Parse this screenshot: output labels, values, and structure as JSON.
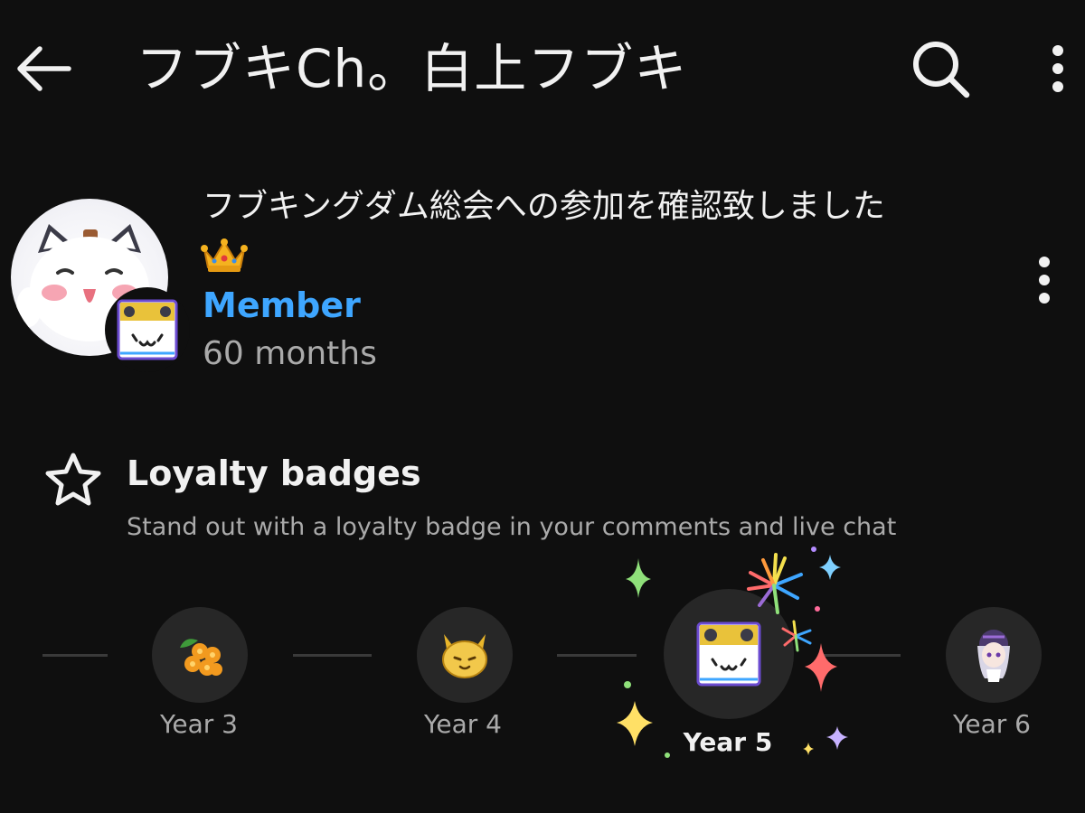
{
  "header": {
    "title": "フブキCh。白上フブキ",
    "back_icon": "arrow-left-icon",
    "search_icon": "search-icon",
    "more_icon": "more-vert-icon"
  },
  "comment": {
    "text": "フブキングダム総会への参加を確認致しました",
    "emoji": "crown-icon",
    "membership": "Member",
    "duration": "60 months"
  },
  "loyalty": {
    "title": "Loyalty badges",
    "subtitle": "Stand out with a loyalty badge in your comments and live chat",
    "badges": [
      {
        "label": "Year 3",
        "icon": "orange-flowers-badge-icon",
        "selected": false
      },
      {
        "label": "Year 4",
        "icon": "golden-fox-badge-icon",
        "selected": false
      },
      {
        "label": "Year 5",
        "icon": "fox-face-badge-icon",
        "selected": true
      },
      {
        "label": "Year 6",
        "icon": "chibi-character-badge-icon",
        "selected": false
      }
    ]
  },
  "colors": {
    "background": "#0f0f0f",
    "accent": "#3ea6ff",
    "secondary_text": "#aaaaaa",
    "badge_bg": "#272727"
  }
}
